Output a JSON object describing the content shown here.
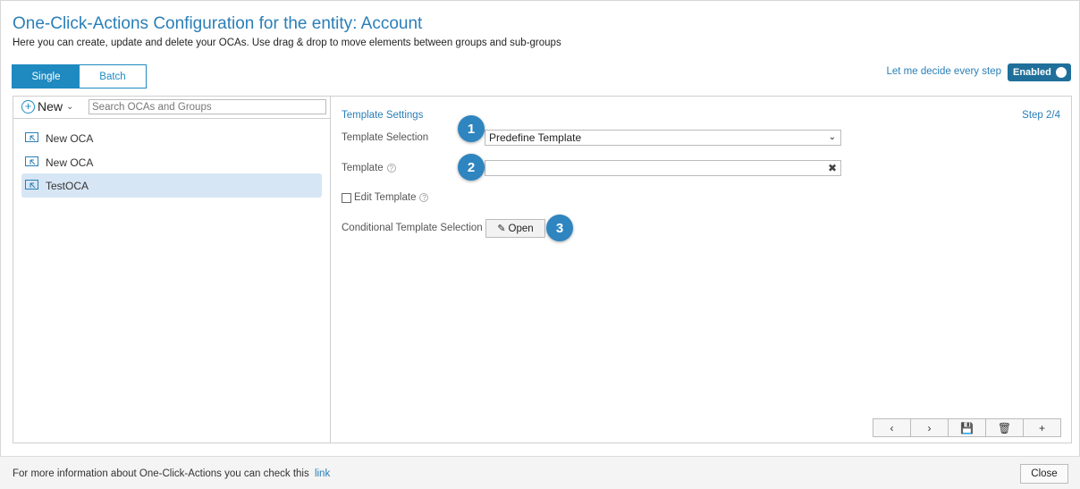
{
  "header": {
    "title": "One-Click-Actions Configuration for the entity: Account",
    "subtitle": "Here you can create, update and delete your OCAs. Use drag & drop to move elements between groups and sub-groups"
  },
  "mode_tabs": [
    {
      "label": "Single",
      "active": true
    },
    {
      "label": "Batch",
      "active": false
    }
  ],
  "decide": {
    "label": "Let me decide every step",
    "toggle_label": "Enabled",
    "toggle_on": true
  },
  "left_panel": {
    "new_label": "New",
    "search_placeholder": "Search OCAs and Groups",
    "items": [
      {
        "label": "New OCA",
        "selected": false
      },
      {
        "label": "New OCA",
        "selected": false
      },
      {
        "label": "TestOCA",
        "selected": true
      }
    ]
  },
  "settings": {
    "section_title": "Template Settings",
    "step": "Step 2/4",
    "template_selection_label": "Template Selection",
    "template_selection_value": "Predefine Template",
    "template_label": "Template",
    "template_value": "",
    "edit_template_label": "Edit Template",
    "edit_template_checked": false,
    "conditional_label": "Conditional Template Selection",
    "open_label": "Open"
  },
  "badges": [
    "1",
    "2",
    "3"
  ],
  "nav_buttons": [
    {
      "icon": "chevron-left-icon",
      "glyph": "‹"
    },
    {
      "icon": "chevron-right-icon",
      "glyph": "›"
    },
    {
      "icon": "save-icon",
      "glyph": "💾"
    },
    {
      "icon": "trash-icon",
      "glyph": "🗑"
    },
    {
      "icon": "plus-icon",
      "glyph": "+"
    }
  ],
  "footer": {
    "text": "For more information about One-Click-Actions you can check this",
    "link_label": "link",
    "close_label": "Close"
  },
  "colors": {
    "accent": "#1f8ac0",
    "title_blue": "#2a7fb8",
    "toggle_bg": "#1f6f9a",
    "badge_bg": "#2e85c0",
    "selected_row": "#d7e6f4"
  }
}
